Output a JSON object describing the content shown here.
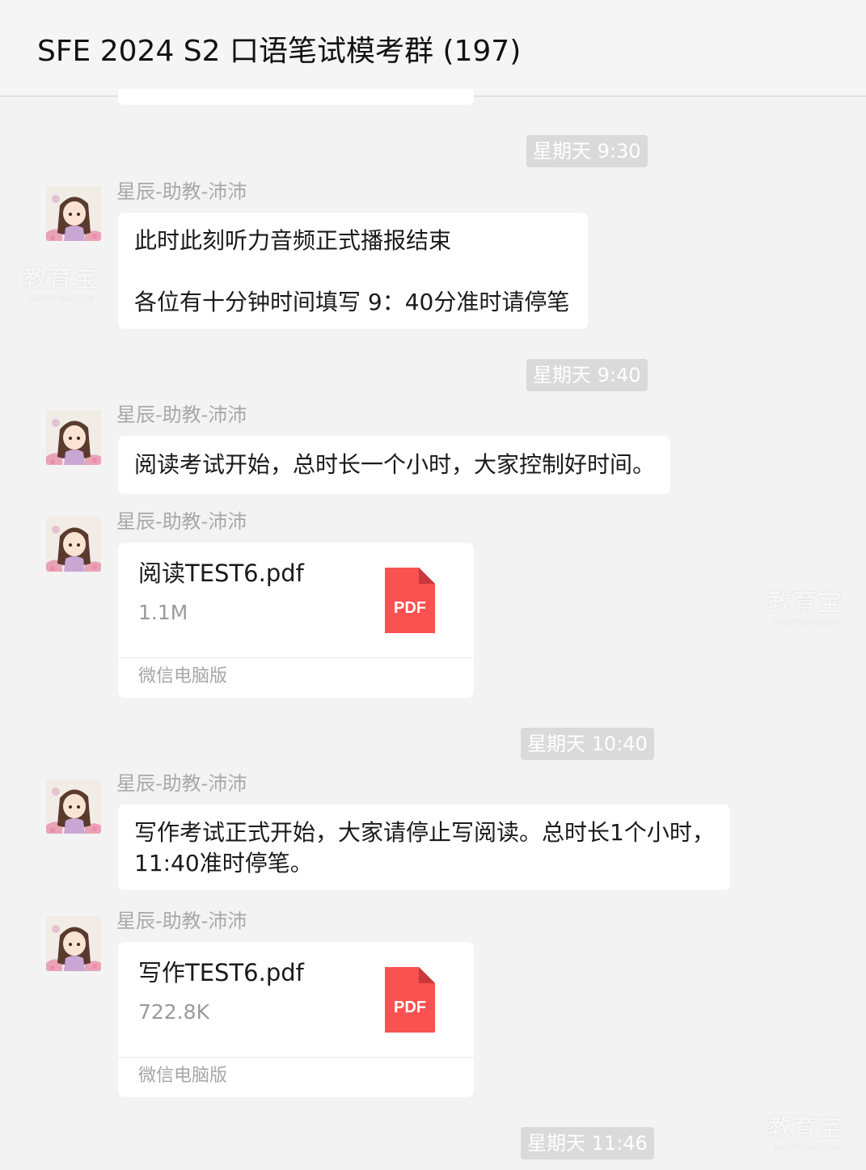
{
  "header": {
    "title": "SFE 2024 S2 口语笔试模考群 (197)"
  },
  "timestamps": [
    "星期天 9:30",
    "星期天 9:40",
    "星期天 10:40",
    "星期天 11:46"
  ],
  "messages": [
    {
      "sender": "星辰-助教-沛沛",
      "lines": [
        "此时此刻听力音频正式播报结束",
        "各位有十分钟时间填写  9：40分准时请停笔"
      ]
    },
    {
      "sender": "星辰-助教-沛沛",
      "lines": [
        "阅读考试开始，总时长一个小时，大家控制好时间。"
      ]
    },
    {
      "sender": "星辰-助教-沛沛",
      "file": {
        "name": "阅读TEST6.pdf",
        "size": "1.1M",
        "icon_label": "PDF",
        "footer": "微信电脑版"
      }
    },
    {
      "sender": "星辰-助教-沛沛",
      "lines": [
        "写作考试正式开始，大家请停止写阅读。总时长1个小时，",
        "11:40准时停笔。"
      ]
    },
    {
      "sender": "星辰-助教-沛沛",
      "file": {
        "name": "写作TEST6.pdf",
        "size": "722.8K",
        "icon_label": "PDF",
        "footer": "微信电脑版"
      }
    }
  ],
  "watermark": {
    "main": "教育宝",
    "sub": "JIAOYUBAO.CN"
  },
  "colors": {
    "background": "#f3f3f3",
    "bubble": "#ffffff",
    "timestamp_bg": "#dadada",
    "pdf_icon": "#fa5151",
    "sender_text": "#a8a8a8"
  },
  "icons": {
    "avatar": "avatar-illustration",
    "file": "pdf-file-icon"
  }
}
